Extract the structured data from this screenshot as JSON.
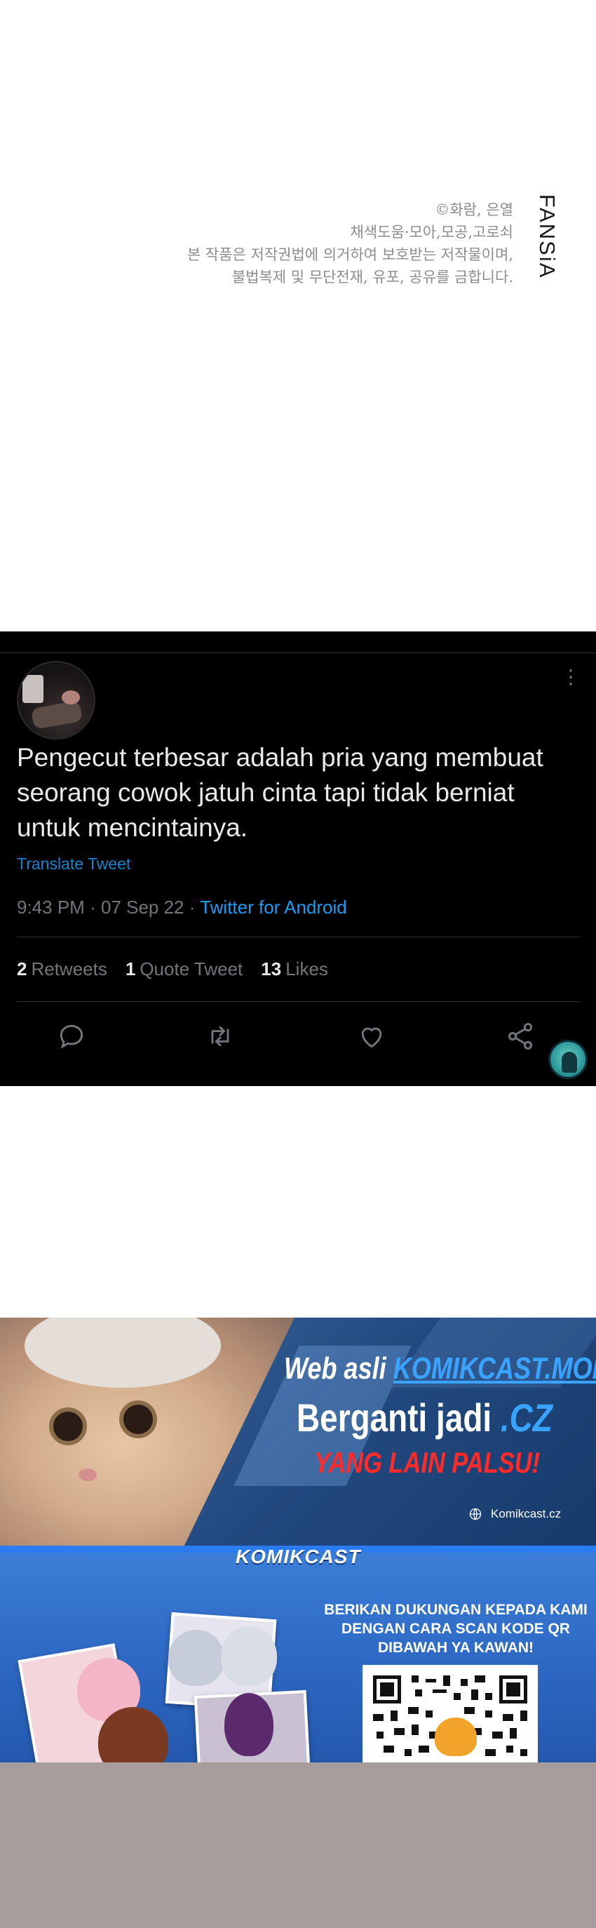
{
  "copyright": {
    "lines": [
      "©화람, 은열",
      "채색도움·모아,모공,고로쇠",
      "본 작품은 저작권법에 의거하여 보호받는 저작물이며,",
      "불법복제 및 무단전재, 유포, 공유를 금합니다."
    ],
    "brand": "FANSiA"
  },
  "tweet": {
    "text": "Pengecut terbesar adalah pria yang membuat seorang cowok jatuh cinta tapi tidak berniat untuk mencintainya.",
    "translate_label": "Translate Tweet",
    "time": "9:43 PM",
    "date": "07 Sep 22",
    "separator": "·",
    "source": "Twitter for Android",
    "stats": {
      "retweets_count": "2",
      "retweets_label": "Retweets",
      "quotes_count": "1",
      "quotes_label": "Quote Tweet",
      "likes_count": "13",
      "likes_label": "Likes"
    },
    "more_icon": "more-vertical-icon",
    "actions": [
      "reply-icon",
      "retweet-icon",
      "like-icon",
      "share-icon"
    ]
  },
  "banner": {
    "web_prefix": "Web asli",
    "old_domain": "KOMIKCAST.MOM",
    "ganti_prefix": "Berganti jadi",
    "new_domain": ".CZ",
    "warning": "YANG LAIN PALSU!",
    "site": "Komikcast.cz",
    "colors": {
      "accent": "#3aa3ff",
      "warning": "#ff2a2a"
    }
  },
  "support": {
    "brand": "KOMIKCAST",
    "ask_lines": [
      "BERIKAN DUKUNGAN KEPADA KAMI",
      "DENGAN CARA SCAN KODE QR",
      "DIBAWAH YA KAWAN!"
    ]
  }
}
